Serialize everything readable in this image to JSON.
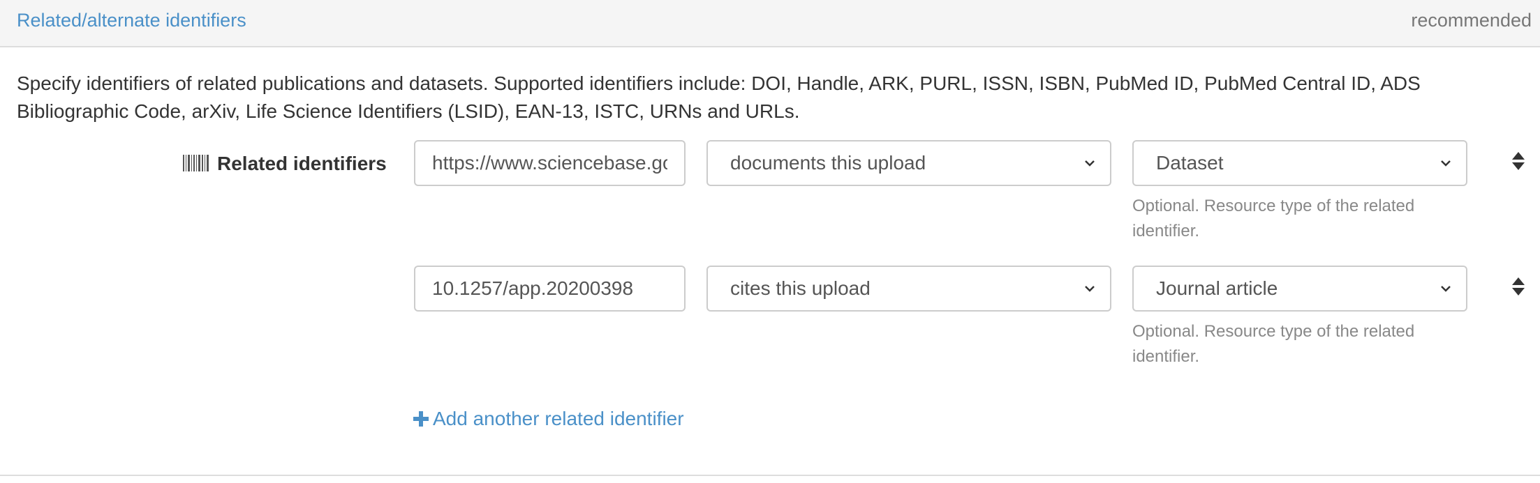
{
  "panel": {
    "title": "Related/alternate identifiers",
    "badge": "recommended"
  },
  "help_text": "Specify identifiers of related publications and datasets. Supported identifiers include: DOI, Handle, ARK, PURL, ISSN, ISBN, PubMed ID, PubMed Central ID, ADS Bibliographic Code, arXiv, Life Science Identifiers (LSID), EAN-13, ISTC, URNs and URLs.",
  "field": {
    "label": "Related identifiers",
    "icon": "barcode-icon"
  },
  "rows": [
    {
      "identifier": "https://www.sciencebase.gov",
      "relation": "documents this upload",
      "resource_type": "Dataset",
      "resource_hint": "Optional. Resource type of the related identifier."
    },
    {
      "identifier": "10.1257/app.20200398",
      "relation": "cites this upload",
      "resource_type": "Journal article",
      "resource_hint": "Optional. Resource type of the related identifier."
    }
  ],
  "add_button": {
    "label": "Add another related identifier",
    "icon": "plus-icon"
  },
  "colors": {
    "link": "#4a90c8",
    "muted": "#888888",
    "border": "#cccccc",
    "heading_bg": "#f5f5f5"
  }
}
